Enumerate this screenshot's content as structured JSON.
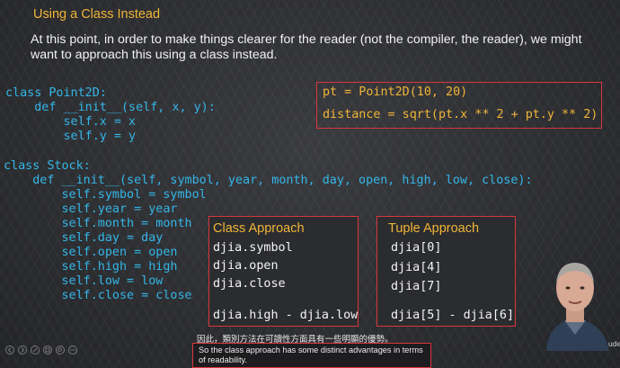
{
  "slide": {
    "title": "Using a Class Instead",
    "intro": "At this point, in order to make things clearer for the reader (not the compiler, the reader), we might want to approach this using a class instead."
  },
  "code_point": [
    "class Point2D:",
    "    def __init__(self, x, y):",
    "        self.x = x",
    "        self.y = y"
  ],
  "code_stock": [
    "class Stock:",
    "    def __init__(self, symbol, year, month, day, open, high, low, close):",
    "        self.symbol = symbol",
    "        self.year = year",
    "        self.month = month",
    "        self.day = day",
    "        self.open = open",
    "        self.high = high",
    "        self.low = low",
    "        self.close = close"
  ],
  "point_example": {
    "line1": "pt = Point2D(10, 20)",
    "line2": "distance = sqrt(pt.x ** 2 + pt.y ** 2)"
  },
  "class_approach": {
    "heading": "Class Approach",
    "lines": [
      "djia.symbol",
      "djia.open",
      "djia.close",
      "djia.high - djia.low"
    ]
  },
  "tuple_approach": {
    "heading": "Tuple Approach",
    "lines": [
      "djia[0]",
      "djia[4]",
      "djia[7]",
      "djia[5] - djia[6]"
    ]
  },
  "subtitles": {
    "zh": "因此，類別方法在可讀性方面具有一些明顯的優勢。",
    "en": "So the class approach has some distinct advantages in terms of readability."
  },
  "brand_text": "ude",
  "colors": {
    "accent": "#f0b537",
    "code": "#34b6e8",
    "highlight_border": "#d9363e"
  },
  "icons": [
    "previous-slide-icon",
    "next-slide-icon",
    "pen-icon",
    "grid-icon",
    "zoom-icon",
    "more-icon"
  ]
}
